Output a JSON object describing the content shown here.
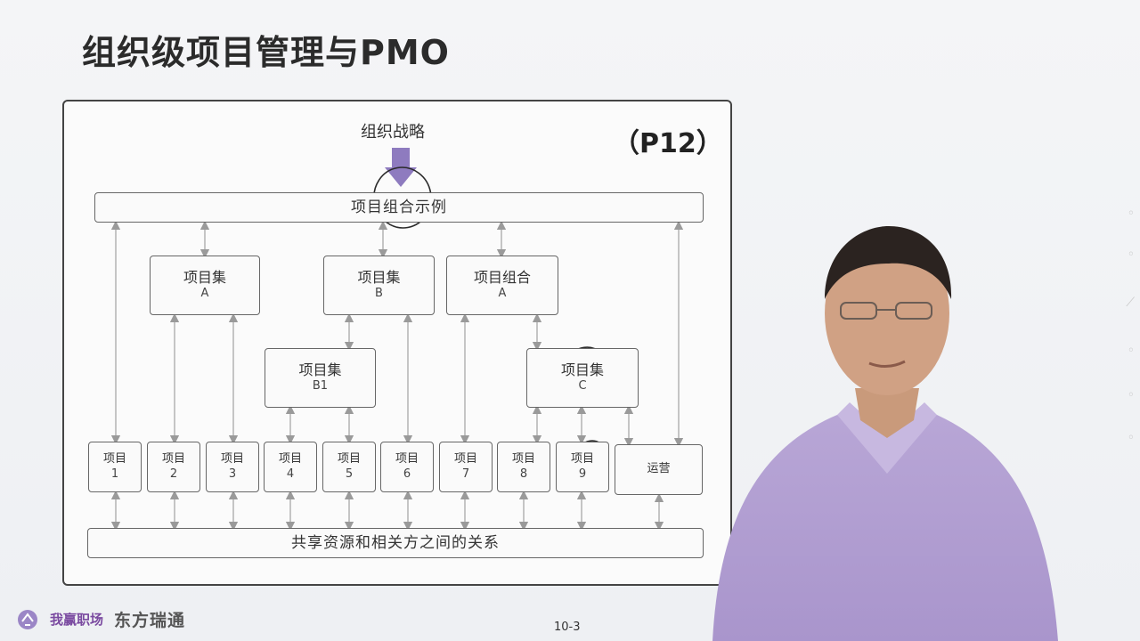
{
  "slide": {
    "title": "组织级项目管理与PMO",
    "page_ref": "（P12）",
    "page_number": "10-3"
  },
  "diagram": {
    "strategy_label": "组织战略",
    "portfolio_label": "项目组合示例",
    "shared_label": "共享资源和相关方之间的关系",
    "level2": [
      {
        "line1": "项目集",
        "line2": "A"
      },
      {
        "line1": "项目集",
        "line2": "B"
      },
      {
        "line1": "项目组合",
        "line2": "A"
      }
    ],
    "level3": [
      {
        "line1": "项目集",
        "line2": "B1"
      },
      {
        "line1": "项目集",
        "line2": "C"
      }
    ],
    "projects": [
      {
        "line1": "项目",
        "line2": "1"
      },
      {
        "line1": "项目",
        "line2": "2"
      },
      {
        "line1": "项目",
        "line2": "3"
      },
      {
        "line1": "项目",
        "line2": "4"
      },
      {
        "line1": "项目",
        "line2": "5"
      },
      {
        "line1": "项目",
        "line2": "6"
      },
      {
        "line1": "项目",
        "line2": "7"
      },
      {
        "line1": "项目",
        "line2": "8"
      },
      {
        "line1": "项目",
        "line2": "9"
      }
    ],
    "operations_label": "运营"
  },
  "footer": {
    "brand_primary": "我赢职场",
    "brand_secondary": "东方瑞通"
  },
  "colors": {
    "strategy_arrow": "#8e7bbf",
    "annotation_ink": "#2a2a2a",
    "brand_purple": "#7a4aa0"
  }
}
